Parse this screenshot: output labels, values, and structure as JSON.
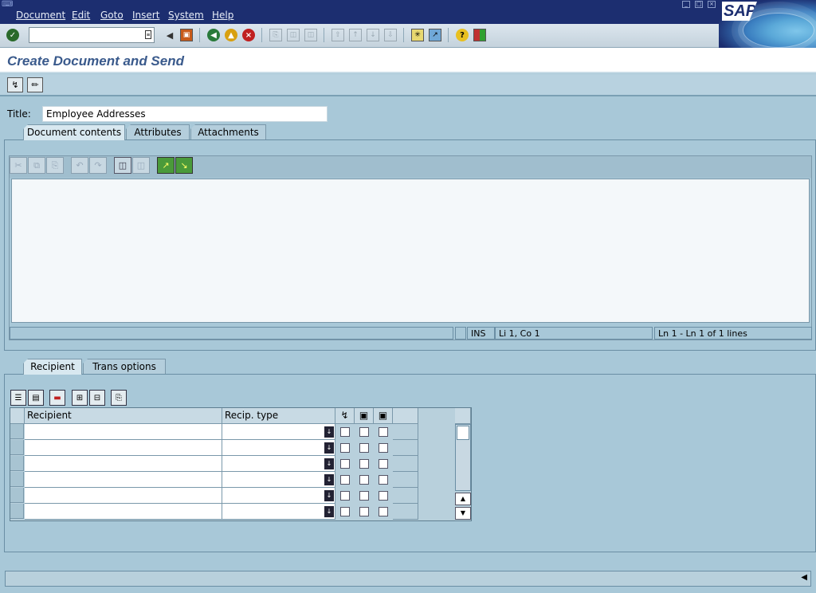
{
  "menubar": {
    "items": [
      "Document",
      "Edit",
      "Goto",
      "Insert",
      "System",
      "Help"
    ]
  },
  "logo": {
    "text": "SAP"
  },
  "toolbar": {
    "command_value": ""
  },
  "page": {
    "title": "Create Document and Send"
  },
  "form": {
    "title_label": "Title:",
    "title_value": "Employee Addresses"
  },
  "doc_tabs": [
    {
      "label": "Document contents",
      "active": true
    },
    {
      "label": "Attributes",
      "active": false
    },
    {
      "label": "Attachments",
      "active": false
    }
  ],
  "editor": {
    "status": {
      "mode": "INS",
      "position": "Li 1, Co 1",
      "lines": "Ln 1 - Ln 1 of 1 lines"
    }
  },
  "recipient_tabs": [
    {
      "label": "Recipient",
      "active": true
    },
    {
      "label": "Trans options",
      "active": false
    }
  ],
  "recipient_table": {
    "columns": [
      "Recipient",
      "Recip. type"
    ],
    "flag_columns": [
      "express-icon",
      "copy-icon",
      "lock-icon"
    ],
    "rows": [
      {
        "recipient": "",
        "recip_type": ""
      },
      {
        "recipient": "",
        "recip_type": ""
      },
      {
        "recipient": "",
        "recip_type": ""
      },
      {
        "recipient": "",
        "recip_type": ""
      },
      {
        "recipient": "",
        "recip_type": ""
      },
      {
        "recipient": "",
        "recip_type": ""
      }
    ]
  },
  "colors": {
    "menubar": "#1c2e70",
    "background": "#a8c8d8",
    "title_text": "#3a5a8c"
  }
}
